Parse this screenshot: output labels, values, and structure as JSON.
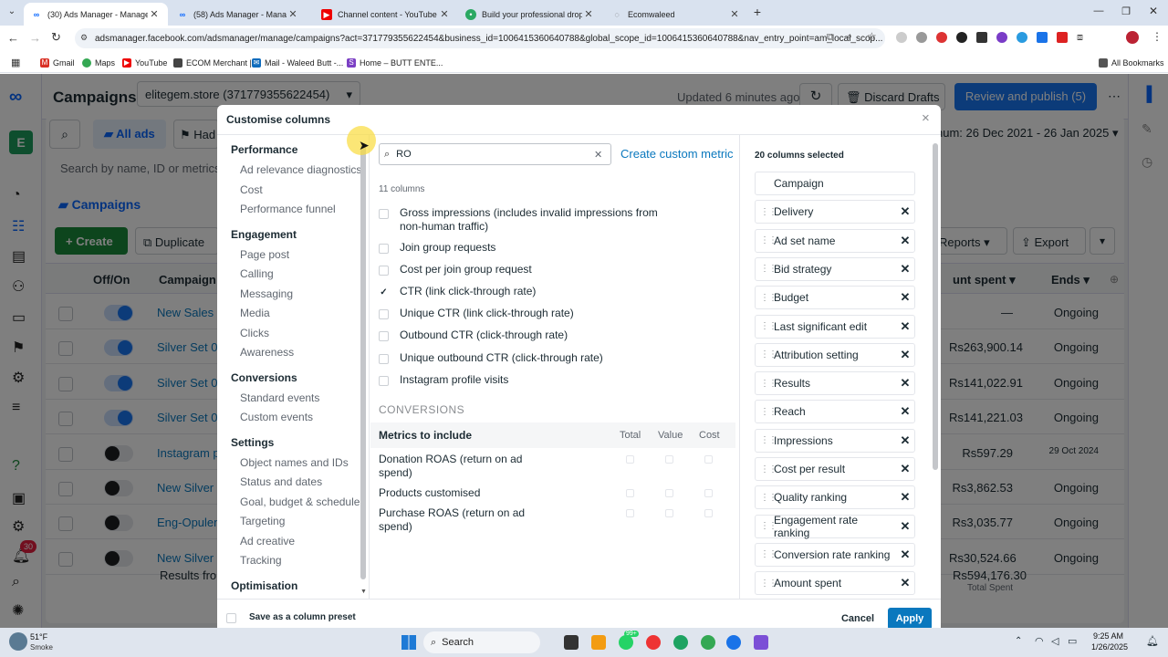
{
  "browser": {
    "tabs": [
      {
        "title": "(30) Ads Manager - Manage ad",
        "active": true
      },
      {
        "title": "(58) Ads Manager - Manage ad",
        "active": false
      },
      {
        "title": "Channel content - YouTube Stu",
        "active": false
      },
      {
        "title": "Build your professional dropsh",
        "active": false
      },
      {
        "title": "Ecomwaleed",
        "active": false
      }
    ],
    "new_tab": "+",
    "url": "adsmanager.facebook.com/adsmanager/manage/campaigns?act=371779355622454&business_id=1006415360640788&global_scope_id=1006415360640788&nav_entry_point=am_local_scop...",
    "bookmarks": [
      "Gmail",
      "Maps",
      "YouTube",
      "ECOM Merchant |",
      "Mail - Waleed Butt -...",
      "Home – BUTT ENTE..."
    ],
    "all_bookmarks": "All Bookmarks"
  },
  "app": {
    "page_title": "Campaigns",
    "account": "elitegem.store (371779355622454)",
    "updated": "Updated 6 minutes ago",
    "discard": "Discard Drafts",
    "review": "Review and publish (5)",
    "date_range": "num: 26 Dec 2021 - 26 Jan 2025",
    "search_placeholder": "Search by name, ID or metrics",
    "all_ads": "All ads",
    "had": "Had",
    "campaigns_tab": "Campaigns",
    "create": "Create",
    "duplicate": "Duplicate",
    "reports": "Reports",
    "export": "Export",
    "col_offon": "Off/On",
    "col_campaign": "Campaign",
    "col_spent": "unt spent",
    "col_ends": "Ends",
    "rows": [
      {
        "name": "New Sales ca",
        "on": true,
        "spent": "—",
        "ends": "Ongoing"
      },
      {
        "name": "Silver Set 06",
        "on": true,
        "spent": "Rs263,900.14",
        "ends": "Ongoing"
      },
      {
        "name": "Silver Set 06",
        "on": true,
        "spent": "Rs141,022.91",
        "ends": "Ongoing"
      },
      {
        "name": "Silver Set 06",
        "on": true,
        "spent": "Rs141,221.03",
        "ends": "Ongoing"
      },
      {
        "name": "Instagram po",
        "on": false,
        "spent": "Rs597.29",
        "ends": "29 Oct 2024"
      },
      {
        "name": "New Silver S",
        "on": false,
        "spent": "Rs3,862.53",
        "ends": "Ongoing"
      },
      {
        "name": "Eng-Opulent",
        "on": false,
        "spent": "Rs3,035.77",
        "ends": "Ongoing"
      },
      {
        "name": "New Silver S",
        "on": false,
        "spent": "Rs30,524.66",
        "ends": "Ongoing"
      }
    ],
    "results_from": "Results from",
    "total_spent_value": "Rs594,176.30",
    "total_spent_label": "Total Spent",
    "notif_count": "30"
  },
  "modal": {
    "title": "Customise columns",
    "close": "×",
    "categories": [
      {
        "heading": "Performance",
        "items": [
          "Ad relevance diagnostics",
          "Cost",
          "Performance funnel"
        ]
      },
      {
        "heading": "Engagement",
        "items": [
          "Page post",
          "Calling",
          "Messaging",
          "Media",
          "Clicks",
          "Awareness"
        ]
      },
      {
        "heading": "Conversions",
        "items": [
          "Standard events",
          "Custom events"
        ]
      },
      {
        "heading": "Settings",
        "items": [
          "Object names and IDs",
          "Status and dates",
          "Goal, budget & schedule",
          "Targeting",
          "Ad creative",
          "Tracking"
        ]
      },
      {
        "heading": "Optimisation",
        "items": []
      }
    ],
    "search_value": "RO",
    "create_metric": "Create custom metric",
    "count_label": "11 columns",
    "options": [
      {
        "label": "Gross impressions (includes invalid impressions from non-human traffic)",
        "checked": false
      },
      {
        "label": "Join group requests",
        "checked": false
      },
      {
        "label": "Cost per join group request",
        "checked": false
      },
      {
        "label": "CTR (link click-through rate)",
        "checked": true
      },
      {
        "label": "Unique CTR (link click-through rate)",
        "checked": false
      },
      {
        "label": "Outbound CTR (click-through rate)",
        "checked": false
      },
      {
        "label": "Unique outbound CTR (click-through rate)",
        "checked": false
      },
      {
        "label": "Instagram profile visits",
        "checked": false
      }
    ],
    "conversions_header": "CONVERSIONS",
    "metrics_header": "Metrics to include",
    "metric_cols": [
      "Total",
      "Value",
      "Cost"
    ],
    "conv_rows": [
      "Donation ROAS (return on ad spend)",
      "Products customised",
      "Purchase ROAS (return on ad spend)"
    ],
    "selected_label": "20 columns selected",
    "selected": [
      "Campaign",
      "Delivery",
      "Ad set name",
      "Bid strategy",
      "Budget",
      "Last significant edit",
      "Attribution setting",
      "Results",
      "Reach",
      "Impressions",
      "Cost per result",
      "Quality ranking",
      "Engagement rate ranking",
      "Conversion rate ranking",
      "Amount spent"
    ],
    "preset": "Save as a column preset",
    "cancel": "Cancel",
    "apply": "Apply"
  },
  "taskbar": {
    "weather_temp": "51°F",
    "weather_desc": "Smoke",
    "search": "Search",
    "badge": "99+",
    "time": "9:25 AM",
    "date": "1/26/2025"
  },
  "colors": {
    "accent": "#1877f2",
    "apply": "#0a78be",
    "green": "#1b8a3a",
    "toggle_on": "#1877f2"
  }
}
